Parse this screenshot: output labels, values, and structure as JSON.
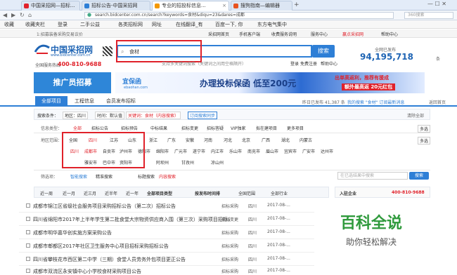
{
  "browser": {
    "tabs": [
      {
        "label": "中国采招网—招标..."
      },
      {
        "label": "招标公告-中国采招网"
      },
      {
        "label": "专业的招投标信息..."
      },
      {
        "label": "搜狗指南—编辑器"
      }
    ],
    "url": "search.bidcenter.com.cn/search?keywords=食材&diqu=23&dares=成都",
    "search_placeholder": "360搜索",
    "bookmarks": [
      "收藏",
      "收藏夹栏",
      "登录",
      "二手公益",
      "各类招标网",
      "网址",
      "在线翻译_有",
      "百度一下, 你",
      "东方电气集中"
    ]
  },
  "topbar": {
    "notice": "1:招募装备采购交易议价",
    "links": [
      "采招网首页",
      "手机客户端",
      "收费服务说明",
      "服务中心",
      "赢点采招网",
      "帮助中心"
    ]
  },
  "header": {
    "logo": "中国采招网",
    "logo_sub": "www.bidcenter.com.cn",
    "hotline_label": "全国服务热线",
    "hotline": "400-810-9688",
    "search_value": "食材",
    "search_button": "搜索",
    "search_tabs": [
      "招标",
      "中标",
      "拟在建",
      "项目",
      "采购",
      "企业",
      "VIP"
    ],
    "hint": "支持多关键词搜索（关键词之间用空格隔开）",
    "login": "登录",
    "register": "免费注册",
    "help": "帮助中心",
    "total_label": "全网已发布",
    "total": "94,195,718",
    "total_unit": "条"
  },
  "banner": {
    "left": "推广员招募",
    "ebao": "宜保函",
    "ebao_sub": "ebaohan.com",
    "main": "办理投标保函  低至200元",
    "right_top": "出单高返利，推荐有援成",
    "right_bottom": "额外最高返 20元红包"
  },
  "subnav": {
    "tabs": [
      "全部项目",
      "工程信息",
      "会员发布招标"
    ],
    "stats": "昨日已发布 41,387 条",
    "right": "我的搜索 \"食材\" 订阅最新消息",
    "return": "返回首页"
  },
  "criteria": {
    "label": "搜索条件：",
    "items": [
      "地区：四川",
      "时间：默认值",
      "关键词：食材（内容搜索）"
    ],
    "subscribe": "订阅搜索同步",
    "clear": "清除全部"
  },
  "type_filter": {
    "label": "信息类型：",
    "items": [
      "全部",
      "招标公告",
      "招标预告",
      "中标结果",
      "招标变更",
      "招标答疑",
      "VIP独家",
      "拟在建项目",
      "更多项目"
    ],
    "more": "多选"
  },
  "region_filter": {
    "label": "地区范围：",
    "top": [
      "全国",
      "四川",
      "江苏",
      "山东",
      "浙江",
      "广东",
      "安徽",
      "河南",
      "河北",
      "北京",
      "广西",
      "湖北",
      "内蒙古"
    ],
    "cities": [
      "四川",
      "成都市",
      "自贡市",
      "泸州市",
      "德阳市",
      "绵阳市",
      "广元市",
      "遂宁市",
      "内江市",
      "乐山市",
      "南充市",
      "眉山市",
      "宜宾市",
      "广安市",
      "达州市"
    ],
    "cities2": [
      "雅安市",
      "巴中市",
      "资阳市",
      "阿坝州",
      "甘孜州",
      "凉山州"
    ],
    "more": "多选"
  },
  "more_filter": {
    "label": "筛选项：",
    "items": [
      "智能搜索",
      "精准搜索",
      "标题搜索",
      "内容搜索"
    ],
    "placeholder": "在已选结果中搜索",
    "button": "搜索"
  },
  "time_row": {
    "items": [
      "近一周",
      "近一月",
      "近三月",
      "近半年",
      "近一年",
      "全部项目类型",
      "按发布时间排",
      "全国范围",
      "全部行业"
    ],
    "total": "查看更多"
  },
  "results": [
    {
      "title": "成都市锦江区省级社会服务项目采购招标公告（第二次）招标公告",
      "type": "招标采购",
      "area": "四川",
      "date": "2017-08-..."
    },
    {
      "title": "四川省绵阳市2017年上半年学生第二批食堂大宗物资供应商入围（第三次）采购项目招标公告/流标公告",
      "type": "招标变更",
      "area": "四川",
      "date": "2017-08-..."
    },
    {
      "title": "成都市明华嘉华创实施方案采购公告",
      "type": "招标采购",
      "area": "四川",
      "date": "2017-08-..."
    },
    {
      "title": "成都市郫都区2017年社区卫生服务中心项目招标采购招标公告",
      "type": "招标采购",
      "area": "四川",
      "date": "2017-08-..."
    },
    {
      "title": "四川省攀枝花市西区第二中学（三期）食堂人员劳务外包项目更正公告",
      "type": "招标采购",
      "area": "四川",
      "date": "2017-08-..."
    },
    {
      "title": "成都市双流区永安镇中心小学校食材采购项目公告",
      "type": "招标采购",
      "area": "四川",
      "date": "2017-08-..."
    }
  ],
  "side": {
    "title": "入驻企业",
    "hotline": "400-810-9688"
  },
  "watermark": {
    "title": "百科全说",
    "sub": "助你轻松解决"
  }
}
